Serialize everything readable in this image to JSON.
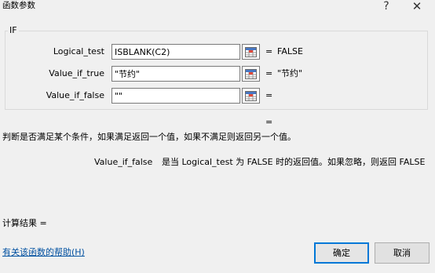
{
  "window": {
    "title": "函数参数",
    "help_glyph": "?",
    "close_glyph": "✕"
  },
  "function_group": {
    "name": "IF",
    "args": [
      {
        "label": "Logical_test",
        "value": "ISBLANK(C2)",
        "result": "FALSE"
      },
      {
        "label": "Value_if_true",
        "value": "\"节约\"",
        "result": "\"节约\""
      },
      {
        "label": "Value_if_false",
        "value": "\"\"",
        "result": ""
      }
    ],
    "equals": "="
  },
  "function_result_eq": "=",
  "function_description": "判断是否满足某个条件，如果满足返回一个值，如果不满足则返回另一个值。",
  "arg_description": {
    "name": "Value_if_false",
    "text": "是当 Logical_test 为 FALSE 时的返回值。如果忽略，则返回 FALSE"
  },
  "calc_result": {
    "label": "计算结果 ="
  },
  "help_link": "有关该函数的帮助(H)",
  "buttons": {
    "ok": "确定",
    "cancel": "取消"
  },
  "icons": {
    "ref_button": "range-selector-icon"
  },
  "colors": {
    "accent": "#0078d7",
    "link": "#0050a0",
    "background": "#f0f0f0"
  }
}
